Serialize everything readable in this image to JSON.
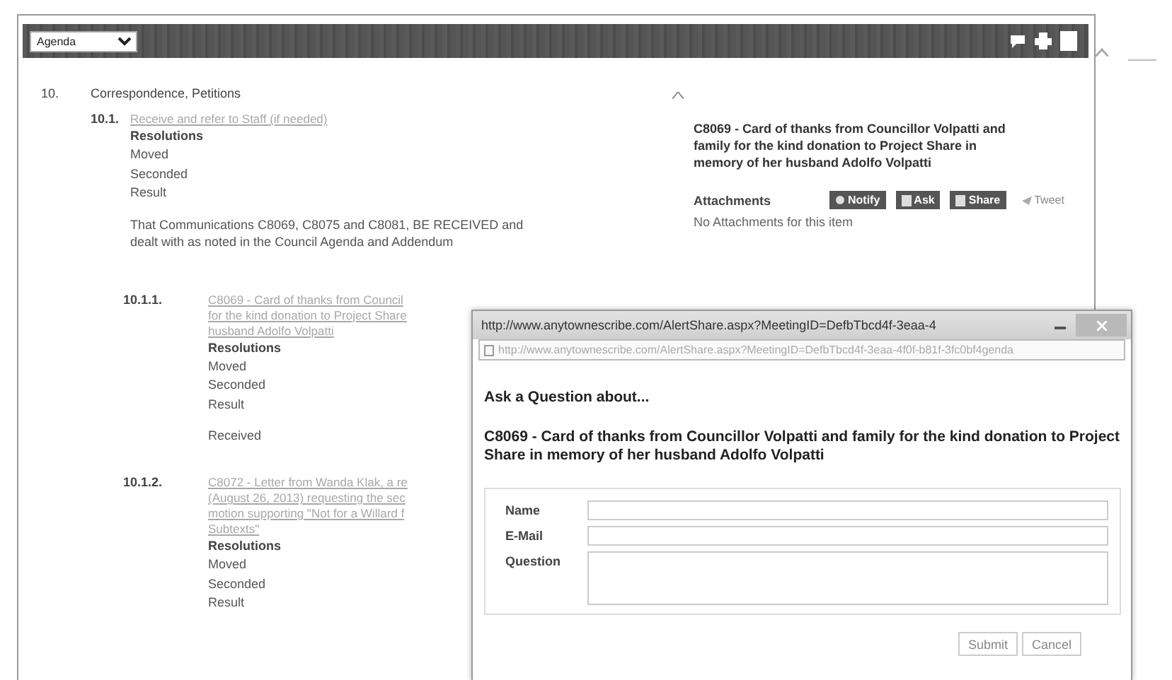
{
  "toolbar": {
    "dropdown": "Agenda"
  },
  "section": {
    "number": "10.",
    "title": "Correspondence, Petitions"
  },
  "items": [
    {
      "number": "10.1.",
      "link_lines": [
        "Receive and refer to Staff (if needed)"
      ],
      "resolutions_label": "Resolutions",
      "resolution_lines": [
        "Moved",
        "Seconded",
        "Result"
      ],
      "outcome": "That Communications C8069, C8075 and C8081, BE RECEIVED and dealt with as noted in the Council Agenda and Addendum",
      "children": [
        {
          "number": "10.1.1.",
          "link_lines": [
            "C8069 - Card of thanks from Council",
            "for the kind donation to Project Share",
            "husband Adolfo Volpatti"
          ],
          "resolutions_label": "Resolutions",
          "resolution_lines": [
            "Moved",
            "Seconded",
            "Result"
          ],
          "outcome": "Received"
        },
        {
          "number": "10.1.2.",
          "link_lines": [
            "C8072 - Letter from Wanda Klak, a re",
            "(August 26, 2013) requesting the sec",
            "motion supporting \"Not for a Willard f",
            "Subtexts\""
          ],
          "resolutions_label": "Resolutions",
          "resolution_lines": [
            "Moved",
            "Seconded",
            "Result"
          ]
        }
      ]
    }
  ],
  "detail": {
    "title": "C8069 - Card of thanks from Councillor Volpatti and family for the kind donation to Project Share in memory of her husband Adolfo Volpatti",
    "attachments_label": "Attachments",
    "share_buttons": [
      {
        "kind": "notify",
        "label": "Notify"
      },
      {
        "kind": "ask",
        "label": "Ask"
      },
      {
        "kind": "share",
        "label": "Share"
      },
      {
        "kind": "tweet",
        "label": "Tweet"
      }
    ],
    "no_attachments": "No Attachments for this item"
  },
  "popup": {
    "title": "http://www.anytownescribe.com/AlertShare.aspx?MeetingID=DefbTbcd4f-3eaa-4",
    "address": "http://www.anytownescribe.com/AlertShare.aspx?MeetingID=DefbTbcd4f-3eaa-4f0f-b81f-3fc0bf4genda",
    "heading": "Ask a Question about...",
    "subject": "C8069 - Card of thanks from Councillor Volpatti and family for the kind donation to Project Share in memory of her husband Adolfo Volpatti",
    "fields": [
      {
        "label": "Name",
        "kind": "line"
      },
      {
        "label": "E-Mail",
        "kind": "line"
      },
      {
        "label": "Question",
        "kind": "area"
      }
    ],
    "buttons": [
      "Submit",
      "Cancel"
    ]
  }
}
